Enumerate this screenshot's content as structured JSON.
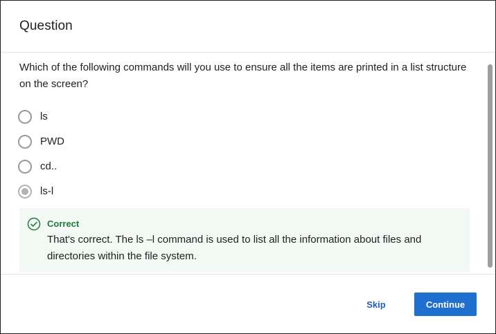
{
  "dialog": {
    "title": "Question"
  },
  "question": {
    "text": "Which of the following commands will you use to ensure all the items are printed in a list structure on the screen?",
    "options": [
      {
        "label": "ls",
        "selected": false
      },
      {
        "label": "PWD",
        "selected": false
      },
      {
        "label": "cd..",
        "selected": false
      },
      {
        "label": "ls-l",
        "selected": true
      }
    ]
  },
  "feedback": {
    "status": "Correct",
    "message": "That's correct. The ls –l command is used to list all the information about files and directories within the file system.",
    "icon": "check-circle-icon",
    "color": "#1e7a3a",
    "background": "#f2f9f4"
  },
  "footer": {
    "skip_label": "Skip",
    "continue_label": "Continue",
    "accent": "#1f6fd1"
  }
}
